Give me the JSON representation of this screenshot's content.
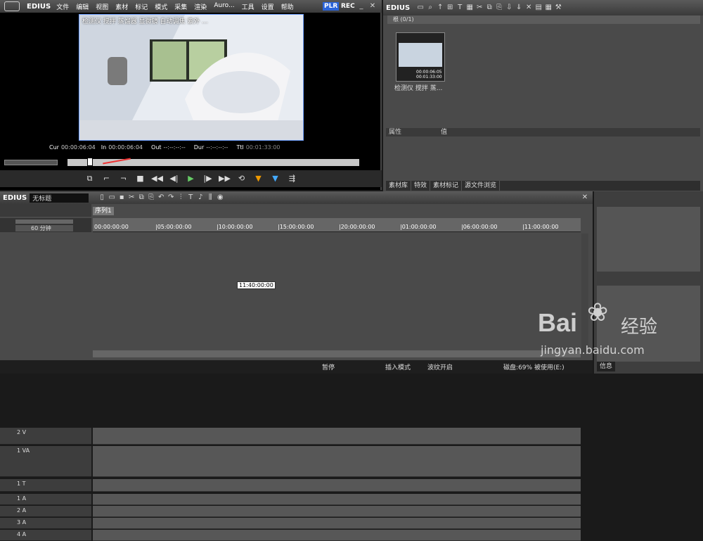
{
  "app": {
    "name": "EDIUS"
  },
  "menu": [
    "文件",
    "编辑",
    "视图",
    "素材",
    "标记",
    "模式",
    "采集",
    "渲染",
    "Auro...",
    "工具",
    "设置",
    "帮助"
  ],
  "player": {
    "mode_plr": "PLR",
    "mode_rec": "REC",
    "overlay": "检测仪 搅拌 蒸馏器 显微镜 自动调焦 紫外 ...",
    "tc": {
      "cur_label": "Cur",
      "cur": "00:00:06:04",
      "in_label": "In",
      "in": "00:00:06:04",
      "out_label": "Out",
      "out": "--:--:--:--",
      "dur_label": "Dur",
      "dur": "--:--:--:--",
      "ttl_label": "Ttl",
      "ttl": "00:01:33:00"
    }
  },
  "bin": {
    "title": "EDIUS",
    "folder": "根 (0/1)",
    "clip": {
      "name": "检测仪 搅拌 蒸...",
      "tc1": "00:00:06:05",
      "tc2": "00:01:33:00"
    },
    "prop_col1": "属性",
    "prop_col2": "值",
    "tabs": [
      "素材库",
      "特效",
      "素材标记",
      "源文件浏览"
    ]
  },
  "timeline": {
    "logo": "EDIUS",
    "project": "无标题",
    "sequence_tab": "序列1",
    "zoom": "60 分钟",
    "ruler": [
      "00:00:00:00",
      "|05:00:00:00",
      "|10:00:00:00",
      "|15:00:00:00",
      "|20:00:00:00",
      "|01:00:00:00",
      "|06:00:00:00",
      "|11:00:00:00"
    ],
    "tracks": [
      {
        "name": "2 V"
      },
      {
        "name": "1 VA"
      },
      {
        "name": "1 T"
      },
      {
        "name": "1 A"
      },
      {
        "name": "2 A"
      },
      {
        "name": "3 A"
      },
      {
        "name": "4 A"
      }
    ],
    "marker": "11:40:00:00",
    "status": {
      "s1": "暂停",
      "s2": "插入模式",
      "s3": "波纹开启",
      "disk": "磁盘:69% 被使用(E:)"
    }
  },
  "info": {
    "tab": "信息"
  },
  "watermark": {
    "brand": "Bai",
    "brand2": "经验",
    "url": "jingyan.baidu.com"
  }
}
